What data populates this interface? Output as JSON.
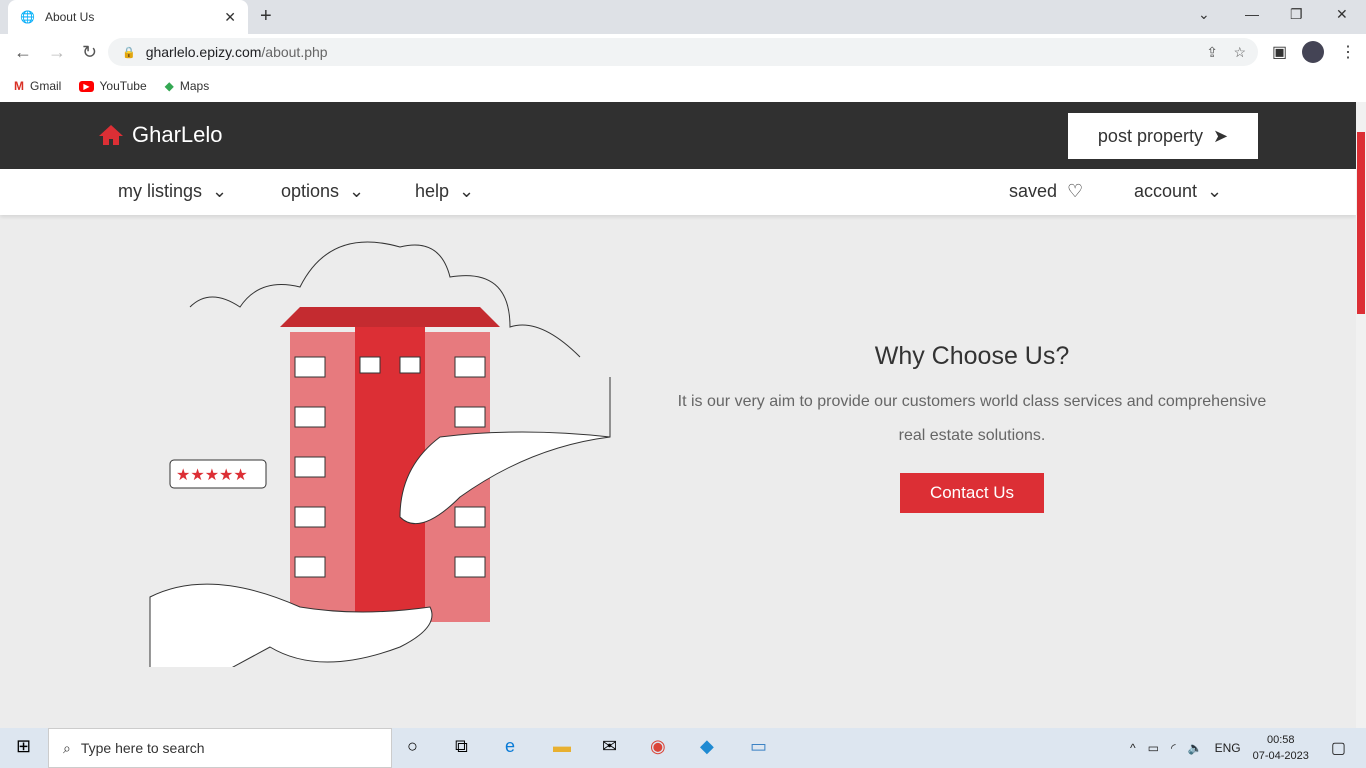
{
  "browser": {
    "tab_title": "About Us",
    "url_host": "gharlelo.epizy.com",
    "url_path": "/about.php",
    "bookmarks": [
      "Gmail",
      "YouTube",
      "Maps"
    ]
  },
  "site": {
    "brand": "GharLelo",
    "post_property": "post property",
    "menu": [
      "my listings",
      "options",
      "help"
    ],
    "saved": "saved",
    "account": "account"
  },
  "hero": {
    "title": "Why Choose Us?",
    "text": "It is our very aim to provide our customers world class services and comprehensive real estate solutions.",
    "cta": "Contact Us"
  },
  "taskbar": {
    "search_placeholder": "Type here to search",
    "lang": "ENG",
    "time": "00:58",
    "date": "07-04-2023"
  },
  "colors": {
    "accent": "#dc2f35",
    "header": "#303030"
  }
}
